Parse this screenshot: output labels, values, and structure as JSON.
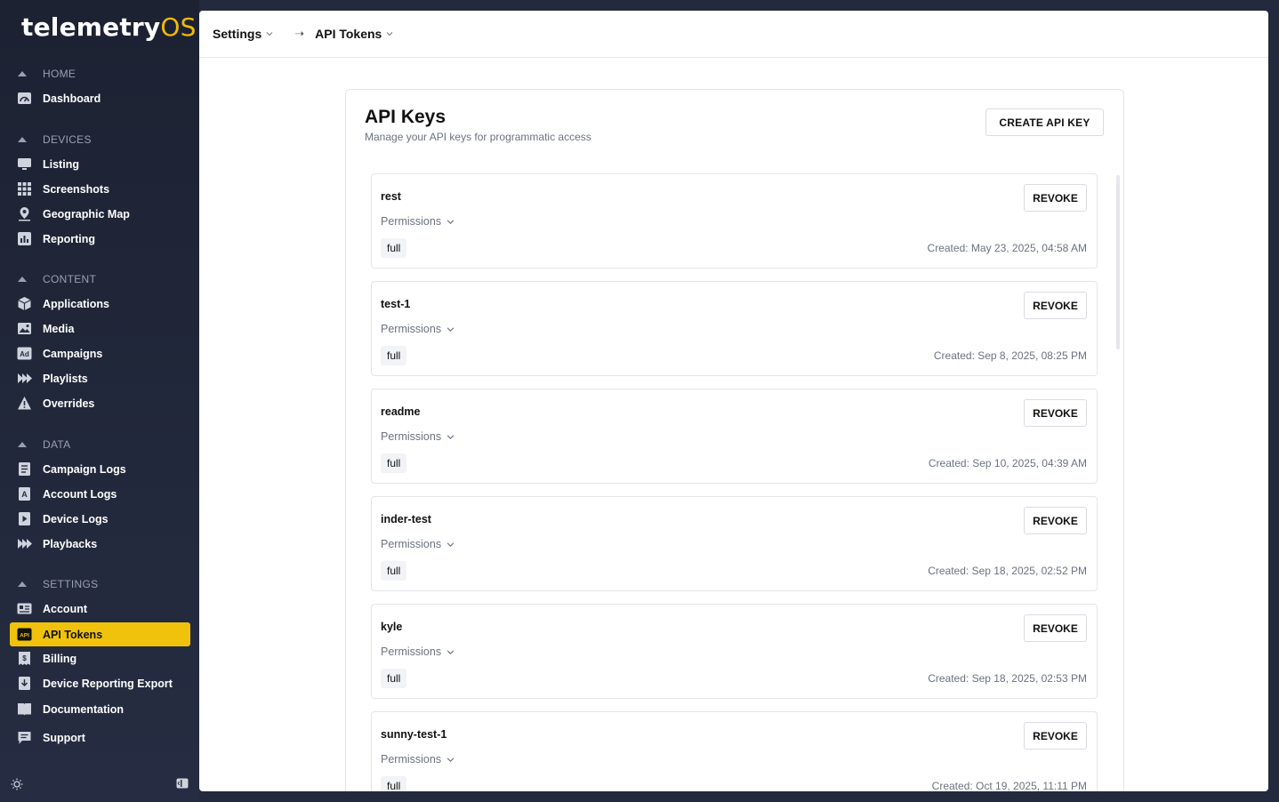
{
  "app": {
    "logo_main": "telemetry",
    "logo_accent": "OS"
  },
  "sidebar": {
    "sections": [
      {
        "label": "HOME",
        "items": [
          {
            "label": "Dashboard",
            "icon": "dashboard-icon"
          }
        ]
      },
      {
        "label": "DEVICES",
        "items": [
          {
            "label": "Listing",
            "icon": "monitor-icon"
          },
          {
            "label": "Screenshots",
            "icon": "grid-icon"
          },
          {
            "label": "Geographic Map",
            "icon": "map-pin-icon"
          },
          {
            "label": "Reporting",
            "icon": "bar-chart-icon"
          }
        ]
      },
      {
        "label": "CONTENT",
        "items": [
          {
            "label": "Applications",
            "icon": "cube-icon"
          },
          {
            "label": "Media",
            "icon": "image-icon"
          },
          {
            "label": "Campaigns",
            "icon": "ad-icon"
          },
          {
            "label": "Playlists",
            "icon": "playlist-icon"
          },
          {
            "label": "Overrides",
            "icon": "warning-icon"
          }
        ]
      },
      {
        "label": "DATA",
        "items": [
          {
            "label": "Campaign Logs",
            "icon": "log-icon"
          },
          {
            "label": "Account Logs",
            "icon": "account-log-icon"
          },
          {
            "label": "Device Logs",
            "icon": "device-log-icon"
          },
          {
            "label": "Playbacks",
            "icon": "playback-icon"
          }
        ]
      },
      {
        "label": "SETTINGS",
        "items": [
          {
            "label": "Account",
            "icon": "id-card-icon"
          },
          {
            "label": "API Tokens",
            "icon": "api-icon"
          },
          {
            "label": "Billing",
            "icon": "billing-icon"
          },
          {
            "label": "Device Reporting Export",
            "icon": "export-icon"
          }
        ]
      }
    ],
    "footer_items": [
      {
        "label": "Documentation",
        "icon": "book-icon"
      },
      {
        "label": "Support",
        "icon": "chat-icon"
      }
    ],
    "active_item": "API Tokens",
    "accent_color": "#f0c20b"
  },
  "breadcrumb": {
    "parent": "Settings",
    "current": "API Tokens"
  },
  "page": {
    "title": "API Keys",
    "subtitle": "Manage your API keys for programmatic access",
    "create_label": "CREATE API KEY"
  },
  "keys": [
    {
      "name": "rest",
      "permissions_label": "Permissions",
      "scope": "full",
      "created": "Created: May 23, 2025, 04:58 AM",
      "revoke_label": "REVOKE"
    },
    {
      "name": "test-1",
      "permissions_label": "Permissions",
      "scope": "full",
      "created": "Created: Sep 8, 2025, 08:25 PM",
      "revoke_label": "REVOKE"
    },
    {
      "name": "readme",
      "permissions_label": "Permissions",
      "scope": "full",
      "created": "Created: Sep 10, 2025, 04:39 AM",
      "revoke_label": "REVOKE"
    },
    {
      "name": "inder-test",
      "permissions_label": "Permissions",
      "scope": "full",
      "created": "Created: Sep 18, 2025, 02:52 PM",
      "revoke_label": "REVOKE"
    },
    {
      "name": "kyle",
      "permissions_label": "Permissions",
      "scope": "full",
      "created": "Created: Sep 18, 2025, 02:53 PM",
      "revoke_label": "REVOKE"
    },
    {
      "name": "sunny-test-1",
      "permissions_label": "Permissions",
      "scope": "full",
      "created": "Created: Oct 19, 2025, 11:11 PM",
      "revoke_label": "REVOKE"
    }
  ]
}
